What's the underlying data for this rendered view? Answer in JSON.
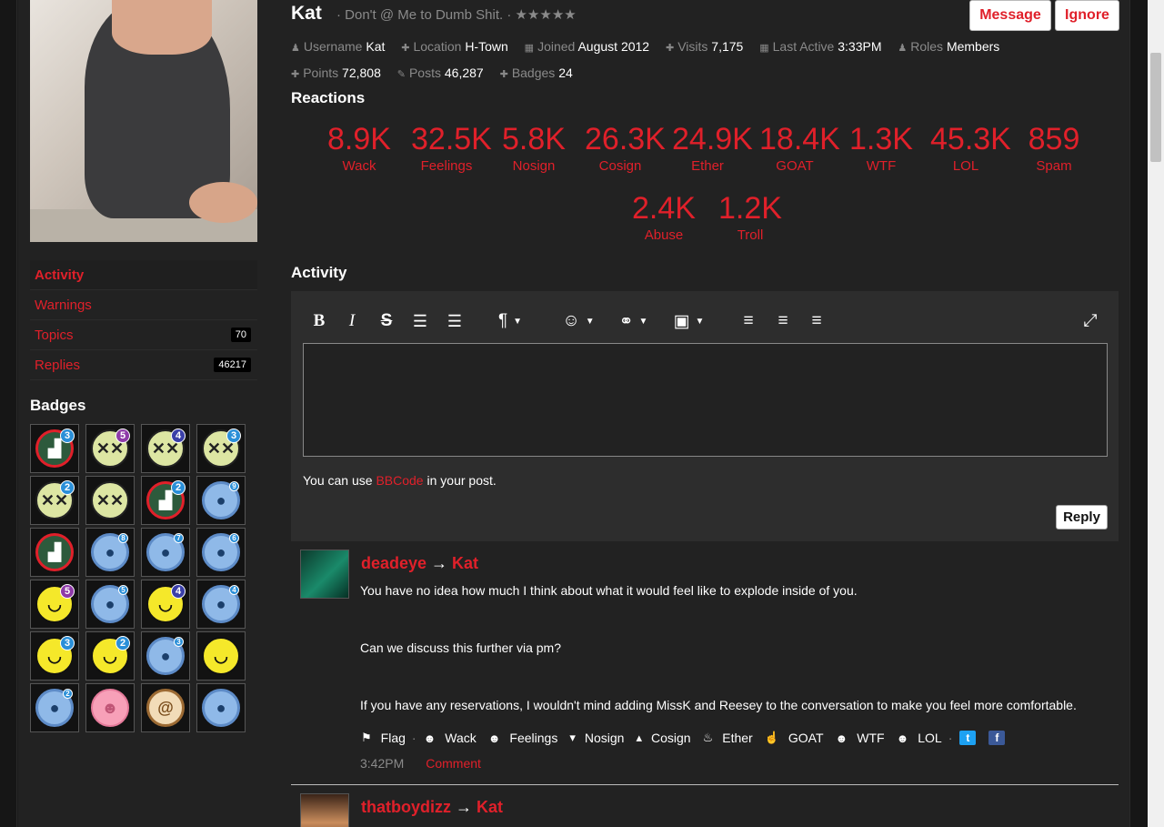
{
  "profile": {
    "name": "Kat",
    "tagline": "· Don't @ Me to Dumb Shit. · ★★★★★",
    "buttons": {
      "message": "Message",
      "ignore": "Ignore"
    },
    "meta": [
      {
        "icon": "user-icon",
        "glyph": "♟",
        "label": "Username",
        "value": "Kat"
      },
      {
        "icon": "location-icon",
        "glyph": "✚",
        "label": "Location",
        "value": "H-Town"
      },
      {
        "icon": "calendar-icon",
        "glyph": "▦",
        "label": "Joined",
        "value": "August 2012"
      },
      {
        "icon": "visits-icon",
        "glyph": "✚",
        "label": "Visits",
        "value": "7,175"
      },
      {
        "icon": "clock-icon",
        "glyph": "▦",
        "label": "Last Active",
        "value": "3:33PM"
      },
      {
        "icon": "roles-icon",
        "glyph": "♟",
        "label": "Roles",
        "value": "Members"
      },
      {
        "icon": "points-icon",
        "glyph": "✚",
        "label": "Points",
        "value": "72,808"
      },
      {
        "icon": "posts-icon",
        "glyph": "✎",
        "label": "Posts",
        "value": "46,287"
      },
      {
        "icon": "badges-icon",
        "glyph": "✚",
        "label": "Badges",
        "value": "24"
      }
    ]
  },
  "reactions": {
    "title": "Reactions",
    "items": [
      {
        "value": "8.9K",
        "label": "Wack"
      },
      {
        "value": "32.5K",
        "label": "Feelings"
      },
      {
        "value": "5.8K",
        "label": "Nosign"
      },
      {
        "value": "26.3K",
        "label": "Cosign"
      },
      {
        "value": "24.9K",
        "label": "Ether"
      },
      {
        "value": "18.4K",
        "label": "GOAT"
      },
      {
        "value": "1.3K",
        "label": "WTF"
      },
      {
        "value": "45.3K",
        "label": "LOL"
      },
      {
        "value": "859",
        "label": "Spam"
      },
      {
        "value": "2.4K",
        "label": "Abuse"
      },
      {
        "value": "1.2K",
        "label": "Troll"
      }
    ]
  },
  "sidebar": {
    "items": [
      {
        "label": "Activity",
        "count": ""
      },
      {
        "label": "Warnings",
        "count": ""
      },
      {
        "label": "Topics",
        "count": "70"
      },
      {
        "label": "Replies",
        "count": "46217"
      }
    ],
    "badges_title": "Badges",
    "badges": [
      {
        "kind": "cake",
        "glyph": "▟",
        "count": "3"
      },
      {
        "kind": "dead",
        "glyph": "✕✕",
        "count": "5",
        "color": "#8e3aa8"
      },
      {
        "kind": "dead",
        "glyph": "✕✕",
        "count": "4",
        "color": "#3a3fa8"
      },
      {
        "kind": "dead",
        "glyph": "✕✕",
        "count": "3",
        "color": "#2a8fd8"
      },
      {
        "kind": "dead",
        "glyph": "✕✕",
        "count": "2",
        "color": "#2a8fd8"
      },
      {
        "kind": "dead",
        "glyph": "✕✕",
        "count": ""
      },
      {
        "kind": "cake",
        "glyph": "▟",
        "count": "2"
      },
      {
        "kind": "chat",
        "glyph": "●",
        "count": "9",
        "small": true
      },
      {
        "kind": "cake",
        "glyph": "▟",
        "count": ""
      },
      {
        "kind": "chat",
        "glyph": "●",
        "count": "8",
        "small": true
      },
      {
        "kind": "chat",
        "glyph": "●",
        "count": "7",
        "small": true
      },
      {
        "kind": "chat",
        "glyph": "●",
        "count": "6",
        "small": true
      },
      {
        "kind": "laugh",
        "glyph": "◡",
        "count": "5",
        "color": "#8e3aa8"
      },
      {
        "kind": "chat",
        "glyph": "●",
        "count": "5",
        "small": true
      },
      {
        "kind": "laugh",
        "glyph": "◡",
        "count": "4",
        "color": "#3a3fa8"
      },
      {
        "kind": "chat",
        "glyph": "●",
        "count": "4",
        "small": true
      },
      {
        "kind": "laugh",
        "glyph": "◡",
        "count": "3",
        "color": "#2a8fd8"
      },
      {
        "kind": "laugh",
        "glyph": "◡",
        "count": "2",
        "color": "#2a8fd8"
      },
      {
        "kind": "chat",
        "glyph": "●",
        "count": "3",
        "small": true
      },
      {
        "kind": "laugh",
        "glyph": "◡",
        "count": ""
      },
      {
        "kind": "chat",
        "glyph": "●",
        "count": "2",
        "small": true
      },
      {
        "kind": "person",
        "glyph": "☻",
        "count": ""
      },
      {
        "kind": "book",
        "glyph": "@",
        "count": ""
      },
      {
        "kind": "chat",
        "glyph": "●",
        "count": ""
      }
    ]
  },
  "activity": {
    "title": "Activity",
    "hint_prefix": "You can use",
    "hint_link": "BBCode",
    "hint_suffix": "in your post.",
    "reply_label": "Reply"
  },
  "comments": [
    {
      "author": "deadeye",
      "arrow": "→",
      "target": "Kat",
      "lines": [
        "You have no idea how much I think about what it would feel like to explode inside of you.",
        "Can we discuss this further via pm?",
        "If you have any reservations, I wouldn't mind adding MissK and Reesey to the conversation to make you feel more comfortable."
      ],
      "actions": [
        "Flag",
        "Wack",
        "Feelings",
        "Nosign",
        "Cosign",
        "Ether",
        "GOAT",
        "WTF",
        "LOL"
      ],
      "time": "3:42PM",
      "comment_label": "Comment"
    },
    {
      "author": "thatboydizz",
      "arrow": "→",
      "target": "Kat"
    }
  ],
  "colors": {
    "accent": "#e0202a",
    "background": "#222222",
    "panel": "#2d2d2d"
  }
}
